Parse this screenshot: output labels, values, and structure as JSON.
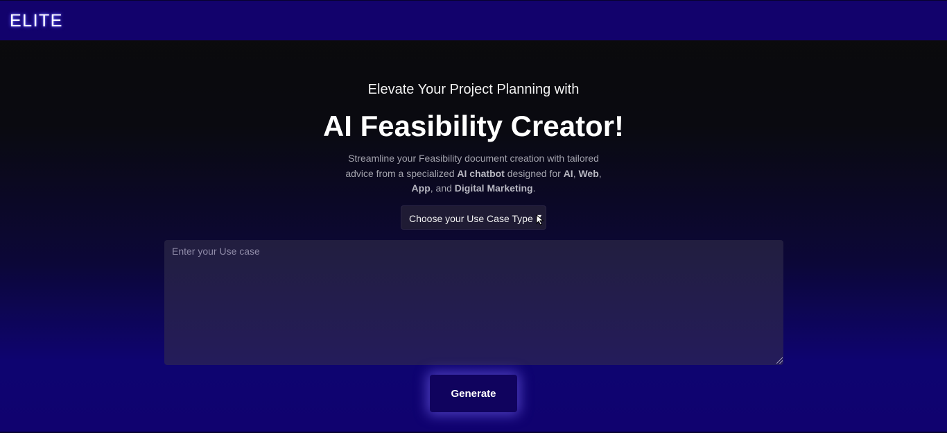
{
  "header": {
    "logo": "ELITE"
  },
  "hero": {
    "tagline": "Elevate Your Project Planning with",
    "headline": "AI Feasibility Creator!",
    "description": {
      "part1": "Streamline your Feasibility document creation with tailored advice from a specialized ",
      "bold1": "AI chatbot",
      "part2": " designed for ",
      "bold2": "AI",
      "part3": ", ",
      "bold3": "Web",
      "part4": ", ",
      "bold4": "App",
      "part5": ", and ",
      "bold5": "Digital Marketing",
      "part6": "."
    }
  },
  "form": {
    "use_case_type_label": "Choose your Use Case Type",
    "use_case_placeholder": "Enter your Use case",
    "generate_label": "Generate"
  },
  "colors": {
    "header_bg": "#12026c",
    "button_bg": "#10035e",
    "textarea_bg": "#221e3f",
    "select_bg": "#1f1b34"
  },
  "icons": {
    "select_arrow": "chevron-down-icon",
    "cursor": "mouse-cursor-icon"
  }
}
